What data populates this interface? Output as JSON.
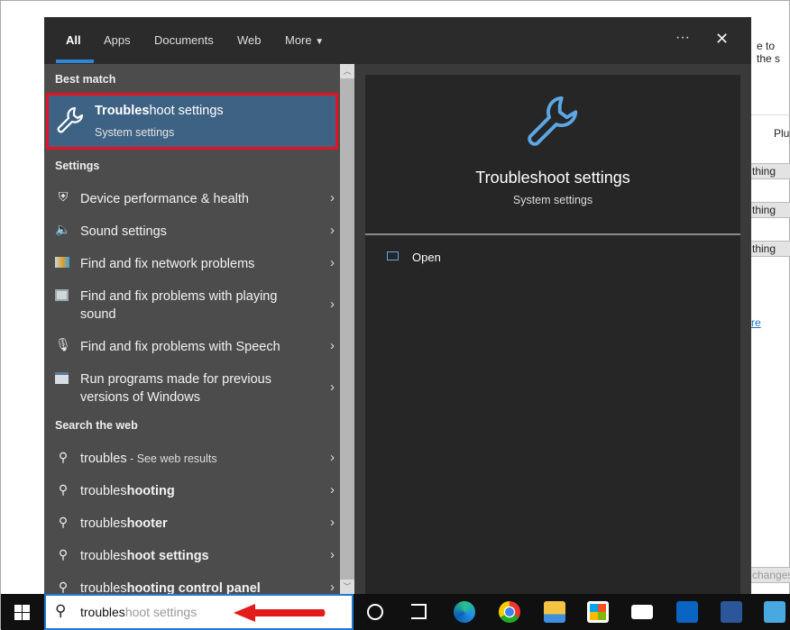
{
  "background": {
    "text_top": "e to the s",
    "plugin_label": "Plu",
    "boxes": [
      "thing",
      "thing",
      "thing"
    ],
    "link": "re",
    "bottom": "changes"
  },
  "header": {
    "tabs": [
      "All",
      "Apps",
      "Documents",
      "Web",
      "More"
    ],
    "more_icon": "caret-down-icon",
    "options_icon": "ellipsis-icon",
    "close_icon": "close-icon",
    "ellipsis": "···",
    "close": "✕"
  },
  "best_match": {
    "heading": "Best match",
    "title_bold": "Troubles",
    "title_rest": "hoot settings",
    "subtitle": "System settings",
    "icon": "wrench-icon",
    "highlight_color": "#e81123"
  },
  "settings": {
    "heading": "Settings",
    "items": [
      {
        "label": "Device performance & health",
        "icon": "shield-icon"
      },
      {
        "label": "Sound settings",
        "icon": "speaker-icon"
      },
      {
        "label": "Find and fix network problems",
        "icon": "network-troubleshoot-icon"
      },
      {
        "label": "Find and fix problems with playing",
        "label2": "sound",
        "icon": "audio-troubleshoot-icon"
      },
      {
        "label": "Find and fix problems with Speech",
        "icon": "microphone-icon"
      },
      {
        "label": "Run programs made for previous",
        "label2": "versions of Windows",
        "icon": "compatibility-icon"
      }
    ]
  },
  "web": {
    "heading": "Search the web",
    "items": [
      {
        "typed": "troubles",
        "rest": "",
        "suffix": " - See web results"
      },
      {
        "typed": "troubles",
        "rest": "hooting"
      },
      {
        "typed": "troubles",
        "rest": "hooter"
      },
      {
        "typed": "troubles",
        "rest": "hoot settings"
      },
      {
        "typed": "troubles",
        "rest": "hooting control panel"
      }
    ]
  },
  "preview": {
    "title": "Troubleshoot settings",
    "subtitle": "System settings",
    "action": "Open",
    "accent": "#5ea7e6"
  },
  "search": {
    "typed": "troubles",
    "suggestion": "hoot settings"
  },
  "taskbar": {
    "icons": [
      "windows-start-icon",
      "cortana-icon",
      "task-view-icon",
      "edge-icon",
      "chrome-icon",
      "file-explorer-icon",
      "store-icon",
      "mail-icon",
      "outlook-icon",
      "word-icon",
      "control-panel-icon"
    ]
  }
}
